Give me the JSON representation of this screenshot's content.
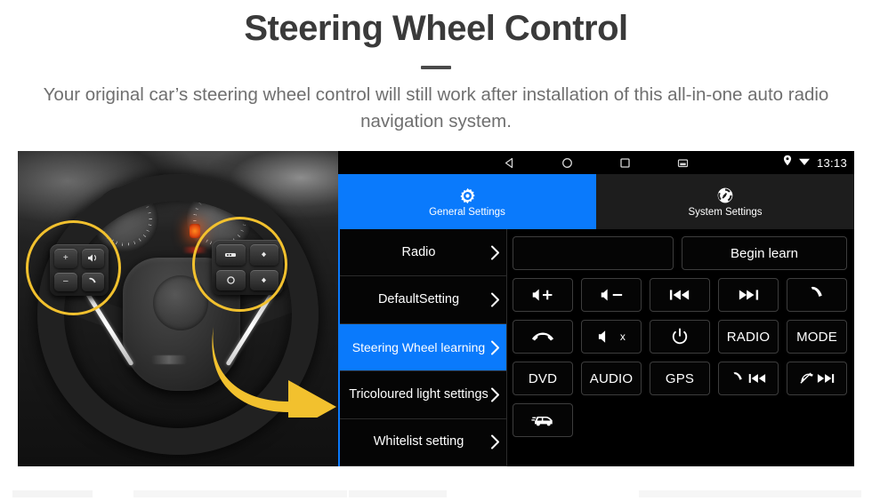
{
  "header": {
    "title": "Steering Wheel Control",
    "subtitle": "Your original car’s steering wheel control will still work after installation of this all-in-one auto radio navigation system."
  },
  "colors": {
    "accent_blue": "#0a7afc",
    "highlight_yellow": "#F2C12E",
    "panel_black": "#000000",
    "button_border": "#3d3d3d",
    "title_gray": "#3a3a3a",
    "subtitle_gray": "#6f6f6f"
  },
  "photo": {
    "alt_name": "steering-wheel-photo",
    "left_pad_keys": [
      "+",
      "−",
      "voice",
      "call"
    ],
    "right_pad_keys": [
      "media",
      "up",
      "mode",
      "down"
    ]
  },
  "unit": {
    "statusbar": {
      "nav_icons": [
        "back-icon",
        "home-icon",
        "recents-icon",
        "screenshot-icon"
      ],
      "location_icon": "location-pin-icon",
      "wifi_icon": "wifi-icon",
      "clock": "13:13"
    },
    "tabs": [
      {
        "label": "General Settings",
        "icon": "gear-icon",
        "active": true
      },
      {
        "label": "System Settings",
        "icon": "system-settings-icon",
        "active": false
      }
    ],
    "menu": [
      {
        "label": "Radio",
        "selected": false
      },
      {
        "label": "DefaultSetting",
        "selected": false
      },
      {
        "label": "Steering Wheel learning",
        "selected": true
      },
      {
        "label": "Tricoloured light settings",
        "selected": false
      },
      {
        "label": "Whitelist setting",
        "selected": false
      }
    ],
    "learn": {
      "display_value": "",
      "begin_button": "Begin learn"
    },
    "buttons": [
      {
        "label": "",
        "icon": "volume-up-icon"
      },
      {
        "label": "",
        "icon": "volume-down-icon"
      },
      {
        "label": "",
        "icon": "previous-track-icon"
      },
      {
        "label": "",
        "icon": "next-track-icon"
      },
      {
        "label": "",
        "icon": "call-answer-icon"
      },
      {
        "label": "",
        "icon": "call-hangup-icon"
      },
      {
        "label": "",
        "icon": "mute-icon"
      },
      {
        "label": "",
        "icon": "power-icon"
      },
      {
        "label": "RADIO",
        "icon": ""
      },
      {
        "label": "MODE",
        "icon": ""
      },
      {
        "label": "DVD",
        "icon": ""
      },
      {
        "label": "AUDIO",
        "icon": ""
      },
      {
        "label": "GPS",
        "icon": ""
      },
      {
        "label": "",
        "icon": "call-previous-icon"
      },
      {
        "label": "",
        "icon": "callend-next-icon"
      },
      {
        "label": "",
        "icon": "car-icon"
      }
    ]
  }
}
